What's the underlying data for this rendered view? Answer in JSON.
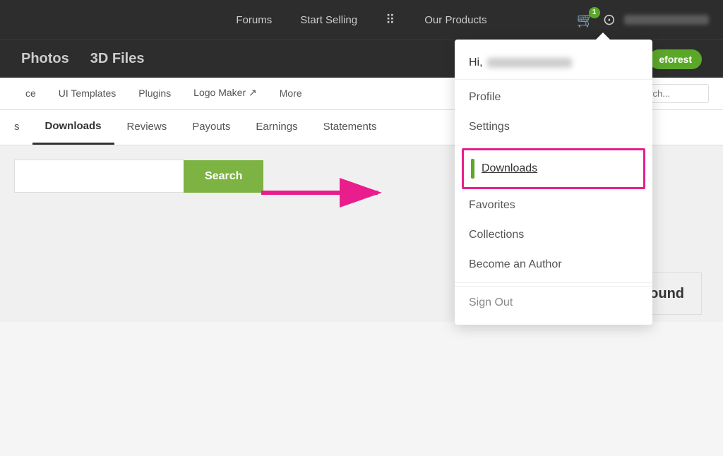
{
  "topNav": {
    "links": [
      "Forums",
      "Start Selling",
      "Our Products"
    ],
    "cartCount": "1",
    "userEmail": "user@example.com"
  },
  "secondNav": {
    "links": [
      "Photos",
      "3D Files"
    ],
    "badge": "eforest"
  },
  "thirdNav": {
    "items": [
      "ce",
      "UI Templates",
      "Plugins",
      "Logo Maker ↗",
      "More"
    ],
    "searchPlaceholder": "Search..."
  },
  "tabs": {
    "items": [
      "s",
      "Downloads",
      "Reviews",
      "Payouts",
      "Earnings",
      "Statements"
    ],
    "active": "Downloads"
  },
  "search": {
    "buttonLabel": "Search",
    "placeholder": ""
  },
  "dropdown": {
    "greeting": "Hi,",
    "profile": "Profile",
    "settings": "Settings",
    "downloads": "Downloads",
    "favorites": "Favorites",
    "collections": "Collections",
    "becomeAuthor": "Become an Author",
    "signOut": "Sign Out"
  },
  "siteground": {
    "name": "SiteGround"
  }
}
